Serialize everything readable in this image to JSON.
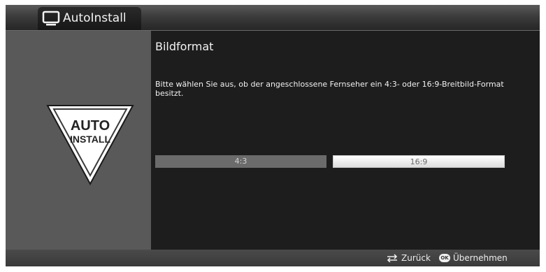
{
  "header": {
    "title": "AutoInstall",
    "icon": "tv-icon"
  },
  "sidebar": {
    "logo_line1": "AUTO",
    "logo_line2": "INSTALL"
  },
  "main": {
    "heading": "Bildformat",
    "description": "Bitte wählen Sie aus, ob der angeschlossene Fernseher ein 4:3- oder 16:9-Breitbild-Format besitzt.",
    "options": [
      {
        "label": "4:3",
        "selected": false
      },
      {
        "label": "16:9",
        "selected": true
      }
    ]
  },
  "footer": {
    "back_label": "Zurück",
    "back_icon": "back-arrows-icon",
    "ok_badge": "OK",
    "ok_label": "Übernehmen",
    "ok_icon": "ok-button-icon"
  },
  "colors": {
    "background": "#1f1f1f",
    "sidebar": "#595959",
    "unselected_option": "#6b6b6b",
    "selected_option": "#ffffff"
  }
}
